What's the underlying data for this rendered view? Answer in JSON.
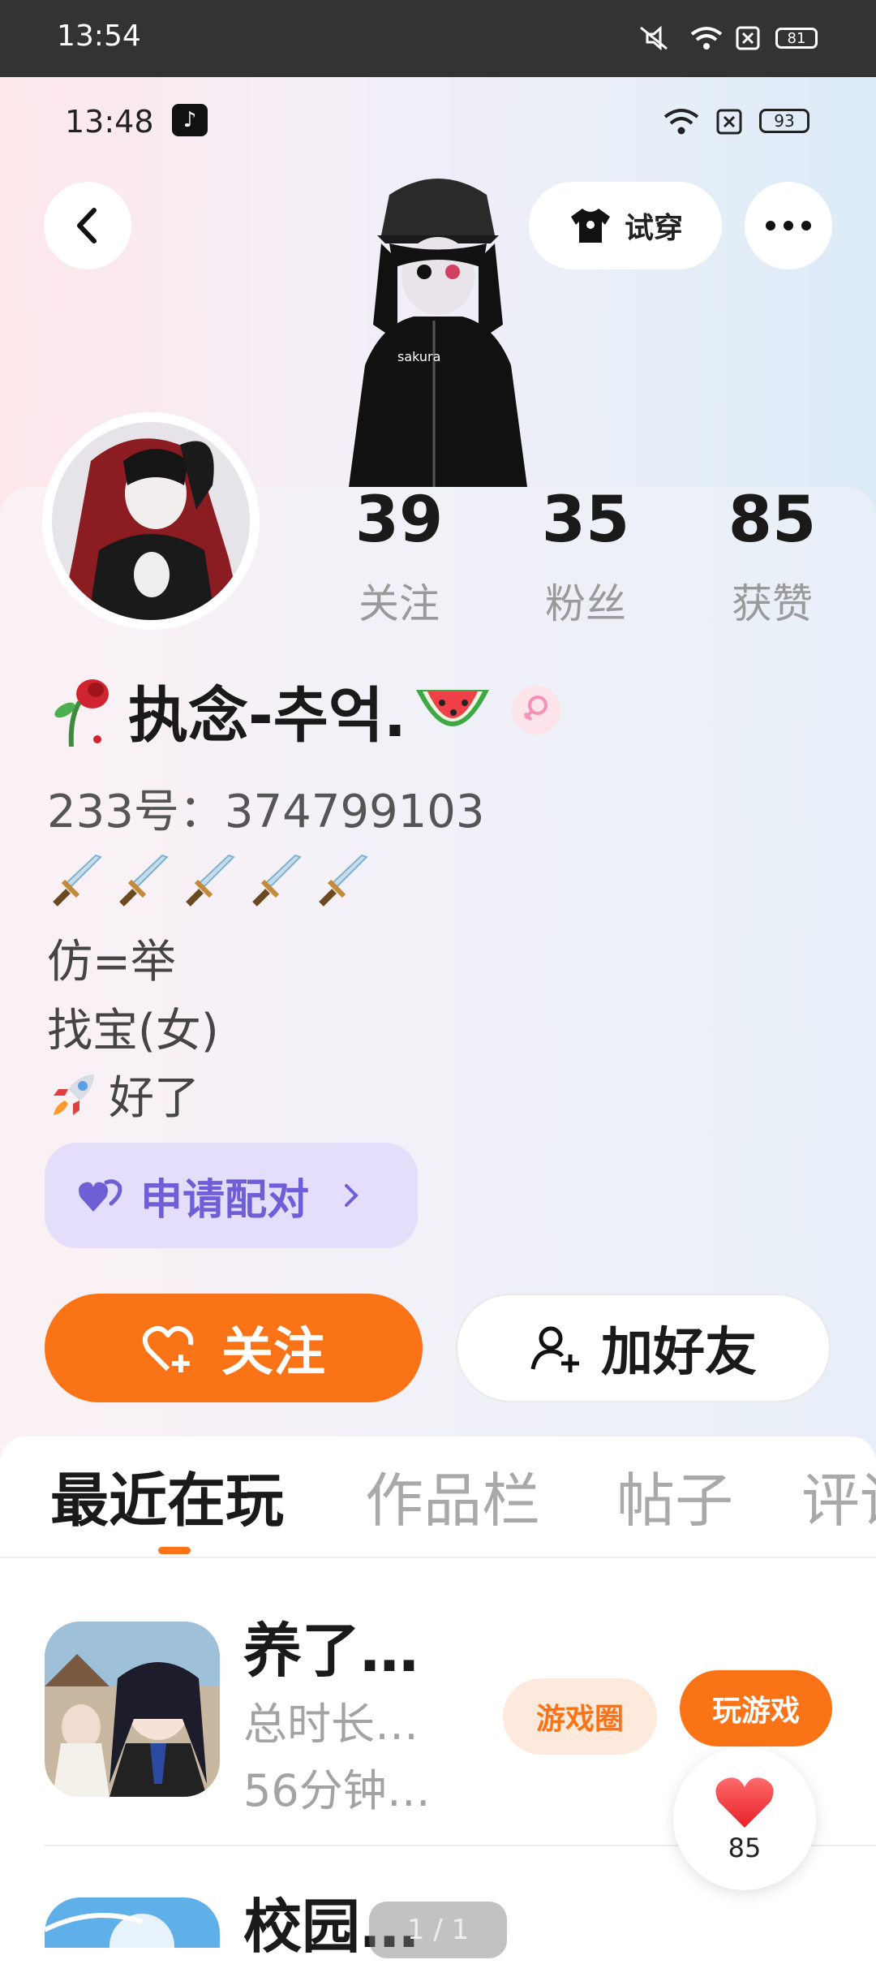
{
  "outer_status": {
    "time": "13:54",
    "battery": "81"
  },
  "inner_status": {
    "time": "13:48",
    "battery": "93"
  },
  "header": {
    "tryon_label": "试穿"
  },
  "stats": [
    {
      "value": "39",
      "label": "关注"
    },
    {
      "value": "35",
      "label": "粉丝"
    },
    {
      "value": "85",
      "label": "获赞"
    }
  ],
  "profile": {
    "nickname": "执念-추억.",
    "id_line": "233号：374799103",
    "bio": [
      "仿=举",
      "找宝(女)",
      "好了"
    ]
  },
  "match": {
    "label": "申请配对"
  },
  "actions": {
    "follow_label": "关注",
    "add_friend_label": "加好友"
  },
  "tabs": [
    "最近在玩",
    "作品栏",
    "帖子",
    "评论"
  ],
  "games": [
    {
      "title": "养了…",
      "line1": "总时长…",
      "line2": "56分钟…",
      "circle_label": "游戏圈",
      "play_label": "玩游戏"
    },
    {
      "title": "校园…"
    }
  ],
  "like_float": {
    "count": "85"
  },
  "pager": {
    "text": "1 / 1"
  },
  "colors": {
    "accent": "#fb7317",
    "match_bg": "#e4defa",
    "match_text": "#6e5fd6",
    "female_badge": "#f590b8"
  }
}
